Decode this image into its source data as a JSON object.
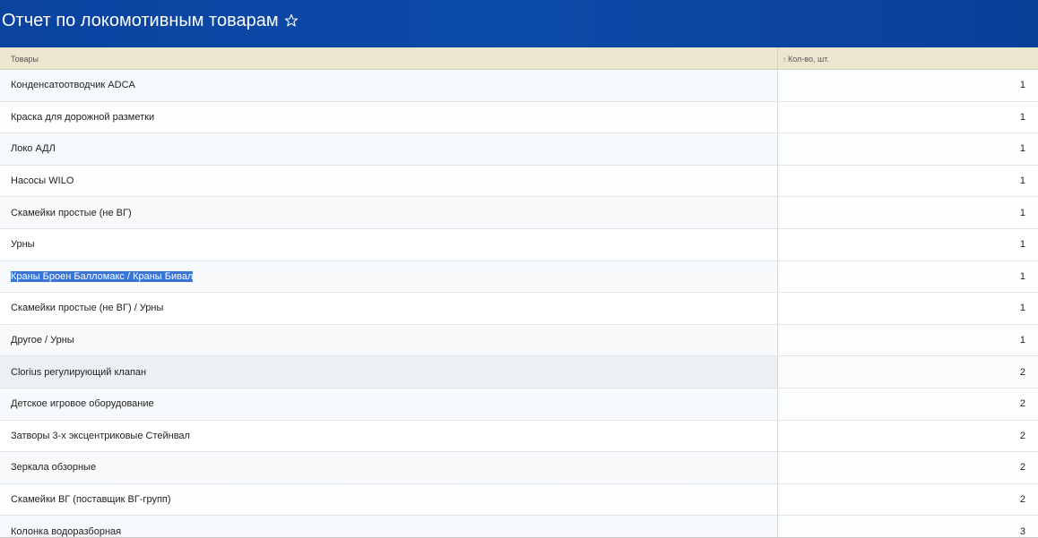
{
  "header": {
    "title": "Отчет по локомотивным товарам",
    "star_icon": "star-outline-icon"
  },
  "table": {
    "columns": [
      {
        "label": "Товары"
      },
      {
        "label": "Кол-во, шт.",
        "sort_icon": "sort-asc-icon",
        "sort_glyph": "↑"
      }
    ],
    "rows": [
      {
        "name": "Конденсатоотводчик ADCA",
        "qty": "1"
      },
      {
        "name": "Краска для дорожной разметки",
        "qty": "1"
      },
      {
        "name": "Локо АДЛ",
        "qty": "1"
      },
      {
        "name": "Насосы WILO",
        "qty": "1"
      },
      {
        "name": "Скамейки простые (не ВГ)",
        "qty": "1"
      },
      {
        "name": "Урны",
        "qty": "1"
      },
      {
        "name": "Краны Броен Балломакс / Краны Бивал",
        "qty": "1",
        "selected": true
      },
      {
        "name": "Скамейки простые (не ВГ) / Урны",
        "qty": "1"
      },
      {
        "name": "Другое / Урны",
        "qty": "1"
      },
      {
        "name": "Clorius регулирующий клапан",
        "qty": "2"
      },
      {
        "name": "Детское игровое оборудование",
        "qty": "2"
      },
      {
        "name": "Затворы 3-х эксцентриковые Стейнвал",
        "qty": "2"
      },
      {
        "name": "Зеркала обзорные",
        "qty": "2"
      },
      {
        "name": "Скамейки ВГ (поставщик ВГ-групп)",
        "qty": "2"
      },
      {
        "name": "Колонка водоразборная",
        "qty": "3"
      }
    ]
  }
}
